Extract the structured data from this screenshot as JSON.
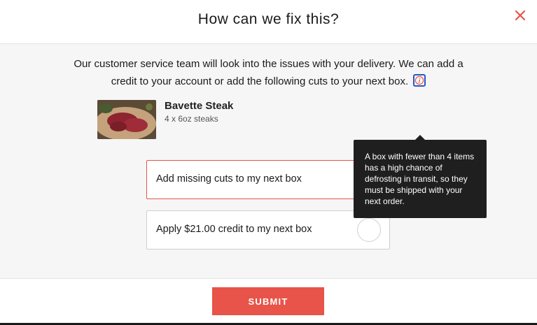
{
  "modal": {
    "title": "How can we fix this?",
    "close_icon": "close-icon",
    "message_line1": "Our customer service team will look into the issues with your delivery. We can add a",
    "message_line2": "credit to your account or add the following cuts to your next box.",
    "info_icon": "info-icon"
  },
  "product": {
    "name": "Bavette Steak",
    "quantity": "4 x 6oz steaks"
  },
  "tooltip": {
    "text": "A box with fewer than 4 items has a high chance of defrosting in transit, so they must be shipped with your next order."
  },
  "options": [
    {
      "label": "Add missing cuts to my next box",
      "selected": true
    },
    {
      "label": "Apply $21.00 credit to my next box",
      "selected": false
    }
  ],
  "footer": {
    "submit_label": "SUBMIT"
  },
  "colors": {
    "accent": "#e8534a",
    "tooltip_bg": "#1f1f1f",
    "focus": "#2458c6"
  }
}
